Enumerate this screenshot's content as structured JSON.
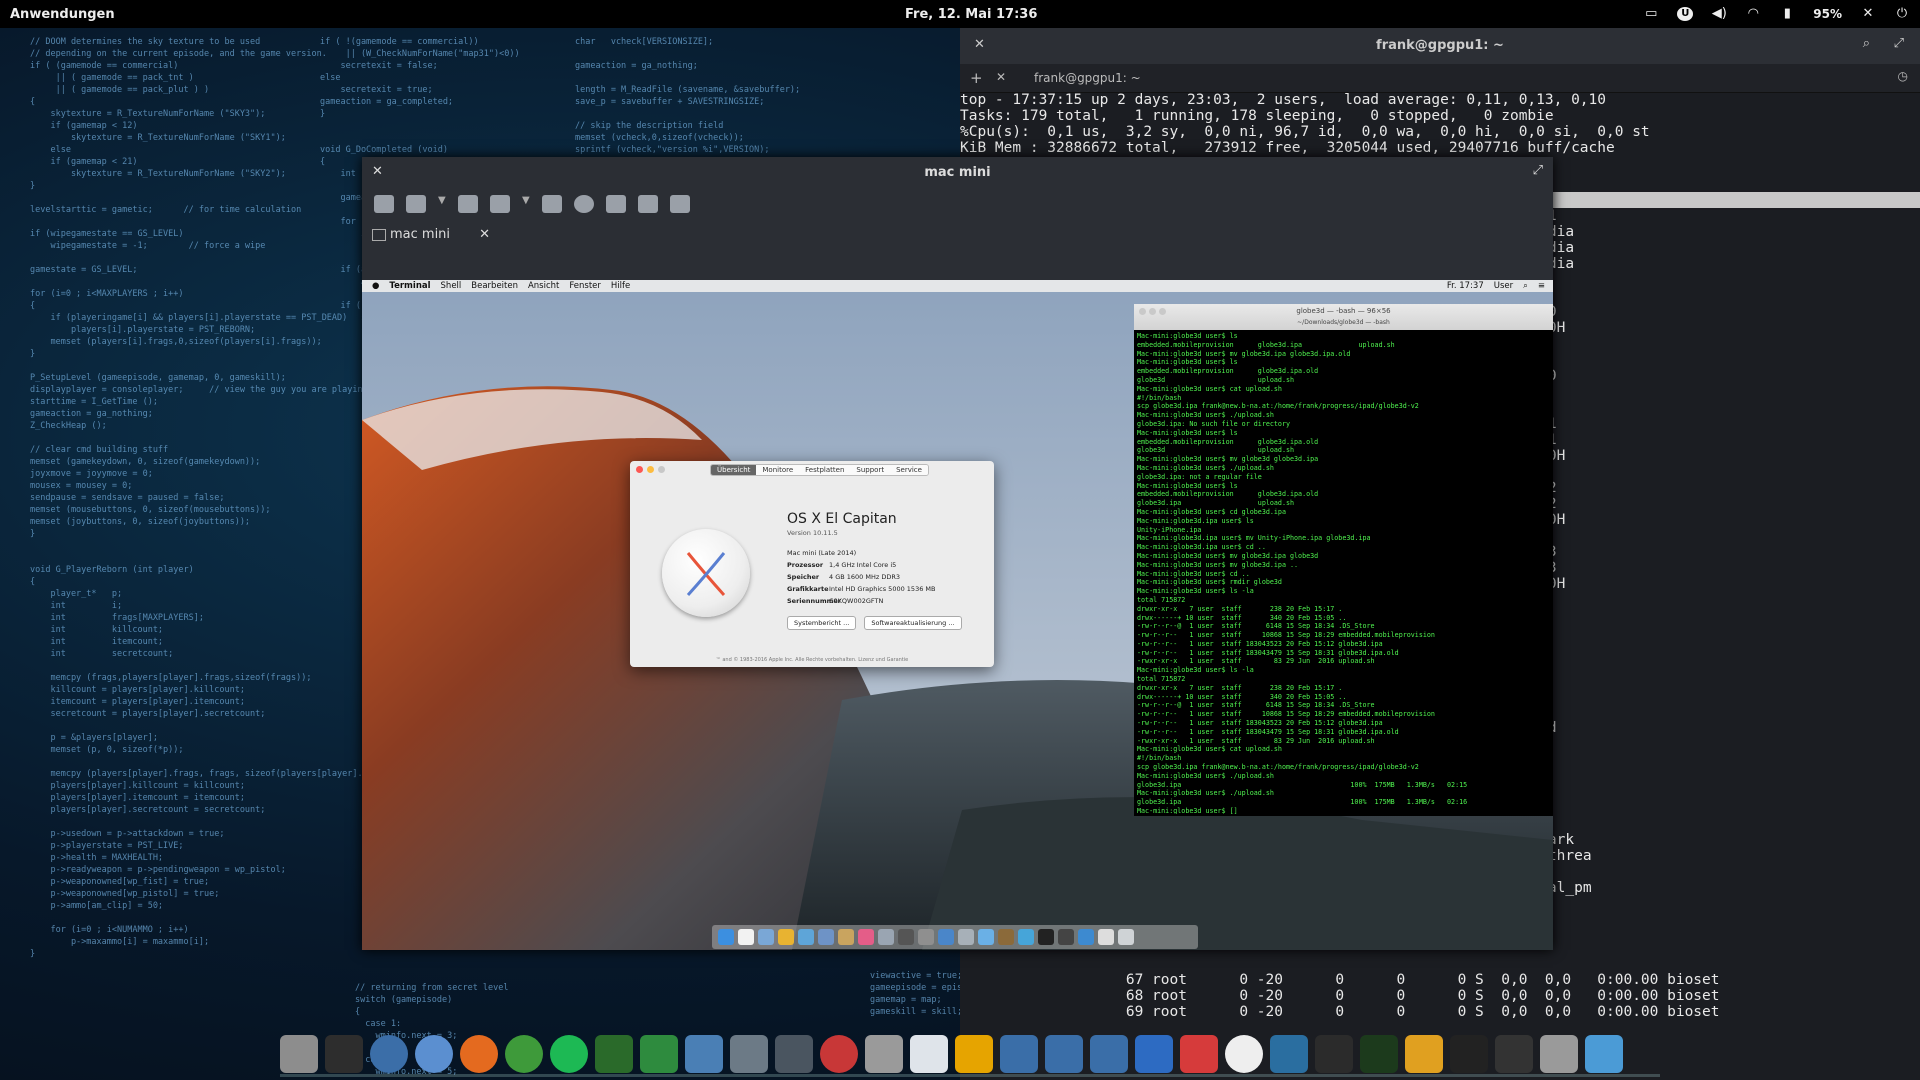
{
  "topbar": {
    "apps_label": "Anwendungen",
    "clock": "Fre, 12. Mai   17:36",
    "battery": "95%",
    "tray_icons": [
      "display-icon",
      "u-app-icon",
      "volume-icon",
      "wifi-icon",
      "battery-icon",
      "notifications-off-icon",
      "power-icon"
    ]
  },
  "terminal": {
    "title": "frank@gpgpu1: ~",
    "tab_label": "frank@gpgpu1: ~",
    "top_lines": [
      "top - 17:37:15 up 2 days, 23:03,  2 users,  load average: 0,11, 0,13, 0,10",
      "Tasks: 179 total,   1 running, 178 sleeping,   0 stopped,   0 zombie",
      "%Cpu(s):  0,1 us,  3,2 sy,  0,0 ni, 96,7 id,  0,0 wa,  0,0 hi,  0,0 si,  0,0 st",
      "KiB Mem : 32886672 total,   273912 free,  3205044 used, 29407716 buff/cache"
    ],
    "proc_right": [
      "D",
      "r/2:1",
      "-nvidia",
      "-nvidia",
      "-nvidia",
      "d",
      "dd",
      "rqd/0",
      "r/0:0H",
      "hed",
      "",
      "ion/0",
      "og/0",
      "og/1",
      "ion/1",
      "rqd/1",
      "r/1:0H",
      "og/2",
      "ion/2",
      "rqd/2",
      "r/2:0H",
      "og/3",
      "ion/3",
      "rqd/3",
      "r/3:0H",
      "pfs",
      "",
      "",
      "askd",
      "ack",
      "",
      "aged",
      "",
      "rityd",
      "",
      "d",
      "f",
      "",
      "q_wq",
      "",
      "fy_mark",
      "fs-kthrea",
      "ld",
      "hermal_pm"
    ],
    "proc_bottom": [
      "                   67 root      0 -20      0      0      0 S  0,0  0,0   0:00.00 bioset",
      "                   68 root      0 -20      0      0      0 S  0,0  0,0   0:00.00 bioset",
      "                   69 root      0 -20      0      0      0 S  0,0  0,0   0:00.00 bioset"
    ]
  },
  "remmina": {
    "title": "mac mini",
    "tab_label": "mac mini"
  },
  "mac": {
    "menubar": [
      "Terminal",
      "Shell",
      "Bearbeiten",
      "Ansicht",
      "Fenster",
      "Hilfe"
    ],
    "menubar_right": [
      "Fr. 17:37",
      "User"
    ],
    "about": {
      "tabs": [
        "Übersicht",
        "Monitore",
        "Festplatten",
        "Support",
        "Service"
      ],
      "os_name": "OS X El Capitan",
      "version": "Version 10.11.5",
      "specs": [
        {
          "k": "",
          "v": "Mac mini (Late 2014)"
        },
        {
          "k": "Prozessor",
          "v": "1,4 GHz Intel Core i5"
        },
        {
          "k": "Speicher",
          "v": "4 GB 1600 MHz DDR3"
        },
        {
          "k": "Grafikkarte",
          "v": "Intel HD Graphics 5000 1536 MB"
        },
        {
          "k": "Seriennummer",
          "v": "C0KQW002GFTN"
        }
      ],
      "buttons": [
        "Systembericht ...",
        "Softwareaktualisierung ..."
      ],
      "footer": "™ and © 1983-2016 Apple Inc. Alle Rechte vorbehalten. Lizenz und Garantie"
    },
    "term": {
      "title": "globe3d — -bash — 96×56",
      "subtitle": "~/Downloads/globe3d — -bash",
      "lines": [
        "Mac-mini:globe3d user$ ls",
        "embedded.mobileprovision      globe3d.ipa              upload.sh",
        "Mac-mini:globe3d user$ mv globe3d.ipa globe3d.ipa.old",
        "Mac-mini:globe3d user$ ls",
        "embedded.mobileprovision      globe3d.ipa.old",
        "globe3d                       upload.sh",
        "Mac-mini:globe3d user$ cat upload.sh",
        "#!/bin/bash",
        "scp globe3d.ipa frank@new.b-na.at:/home/frank/progress/ipad/globe3d-v2",
        "Mac-mini:globe3d user$ ./upload.sh",
        "globe3d.ipa: No such file or directory",
        "Mac-mini:globe3d user$ ls",
        "embedded.mobileprovision      globe3d.ipa.old",
        "globe3d                       upload.sh",
        "Mac-mini:globe3d user$ mv globe3d globe3d.ipa",
        "Mac-mini:globe3d user$ ./upload.sh",
        "globe3d.ipa: not a regular file",
        "Mac-mini:globe3d user$ ls",
        "embedded.mobileprovision      globe3d.ipa.old",
        "globe3d.ipa                   upload.sh",
        "Mac-mini:globe3d user$ cd globe3d.ipa",
        "Mac-mini:globe3d.ipa user$ ls",
        "Unity-iPhone.ipa",
        "Mac-mini:globe3d.ipa user$ mv Unity-iPhone.ipa globe3d.ipa",
        "Mac-mini:globe3d.ipa user$ cd ..",
        "Mac-mini:globe3d user$ mv globe3d.ipa globe3d",
        "Mac-mini:globe3d user$ mv globe3d.ipa ..",
        "Mac-mini:globe3d user$ cd ..",
        "Mac-mini:globe3d user$ rmdir globe3d",
        "Mac-mini:globe3d user$ ls -la",
        "total 715872",
        "drwxr-xr-x   7 user  staff       238 20 Feb 15:17 .",
        "drwx------+ 10 user  staff       340 20 Feb 15:05 ..",
        "-rw-r--r--@  1 user  staff      6148 15 Sep 18:34 .DS_Store",
        "-rw-r--r--   1 user  staff     10868 15 Sep 18:29 embedded.mobileprovision",
        "-rw-r--r--   1 user  staff 183043523 20 Feb 15:12 globe3d.ipa",
        "-rw-r--r--   1 user  staff 183043479 15 Sep 18:31 globe3d.ipa.old",
        "-rwxr-xr-x   1 user  staff        83 29 Jun  2016 upload.sh",
        "Mac-mini:globe3d user$ ls -la",
        "total 715872",
        "drwxr-xr-x   7 user  staff       238 20 Feb 15:17 .",
        "drwx------+ 10 user  staff       340 20 Feb 15:05 ..",
        "-rw-r--r--@  1 user  staff      6148 15 Sep 18:34 .DS_Store",
        "-rw-r--r--   1 user  staff     10868 15 Sep 18:29 embedded.mobileprovision",
        "-rw-r--r--   1 user  staff 183043523 20 Feb 15:12 globe3d.ipa",
        "-rw-r--r--   1 user  staff 183043479 15 Sep 18:31 globe3d.ipa.old",
        "-rwxr-xr-x   1 user  staff        83 29 Jun  2016 upload.sh",
        "Mac-mini:globe3d user$ cat upload.sh",
        "#!/bin/bash",
        "scp globe3d.ipa frank@new.b-na.at:/home/frank/progress/ipad/globe3d-v2",
        "Mac-mini:globe3d user$ ./upload.sh",
        "globe3d.ipa                                          100%  175MB   1.3MB/s   02:15",
        "Mac-mini:globe3d user$ ./upload.sh",
        "globe3d.ipa                                          100%  175MB   1.3MB/s   02:16",
        "Mac-mini:globe3d user$ []"
      ]
    }
  },
  "wallpaper": {
    "col1": "// DOOM determines the sky texture to be used\n// depending on the current episode, and the game version.\nif ( (gamemode == commercial)\n     || ( gamemode == pack_tnt )\n     || ( gamemode == pack_plut ) )\n{\n    skytexture = R_TextureNumForName (\"SKY3\");\n    if (gamemap < 12)\n        skytexture = R_TextureNumForName (\"SKY1\");\n    else\n    if (gamemap < 21)\n        skytexture = R_TextureNumForName (\"SKY2\");\n}\n\nlevelstarttic = gametic;      // for time calculation\n\nif (wipegamestate == GS_LEVEL)\n    wipegamestate = -1;        // force a wipe\n\ngamestate = GS_LEVEL;\n\nfor (i=0 ; i<MAXPLAYERS ; i++)\n{\n    if (playeringame[i] && players[i].playerstate == PST_DEAD)\n        players[i].playerstate = PST_REBORN;\n    memset (players[i].frags,0,sizeof(players[i].frags));\n}\n\nP_SetupLevel (gameepisode, gamemap, 0, gameskill);\ndisplayplayer = consoleplayer;     // view the guy you are playing\nstarttime = I_GetTime ();\ngameaction = ga_nothing;\nZ_CheckHeap ();\n\n// clear cmd building stuff\nmemset (gamekeydown, 0, sizeof(gamekeydown));\njoyxmove = joyymove = 0;\nmousex = mousey = 0;\nsendpause = sendsave = paused = false;\nmemset (mousebuttons, 0, sizeof(mousebuttons));\nmemset (joybuttons, 0, sizeof(joybuttons));\n}\n\n\nvoid G_PlayerReborn (int player)\n{\n    player_t*   p;\n    int         i;\n    int         frags[MAXPLAYERS];\n    int         killcount;\n    int         itemcount;\n    int         secretcount;\n\n    memcpy (frags,players[player].frags,sizeof(frags));\n    killcount = players[player].killcount;\n    itemcount = players[player].itemcount;\n    secretcount = players[player].secretcount;\n\n    p = &players[player];\n    memset (p, 0, sizeof(*p));\n\n    memcpy (players[player].frags, frags, sizeof(players[player].frags));\n    players[player].killcount = killcount;\n    players[player].itemcount = itemcount;\n    players[player].secretcount = secretcount;\n\n    p->usedown = p->attackdown = true;\n    p->playerstate = PST_LIVE;\n    p->health = MAXHEALTH;\n    p->readyweapon = p->pendingweapon = wp_pistol;\n    p->weaponowned[wp_fist] = true;\n    p->weaponowned[wp_pistol] = true;\n    p->ammo[am_clip] = 50;\n\n    for (i=0 ; i<NUMAMMO ; i++)\n        p->maxammo[i] = maxammo[i];\n}",
    "col2": "if ( !(gamemode == commercial))\n     || (W_CheckNumForName(\"map31\")<0))\n    secretexit = false;\nelse\n    secretexit = true;\ngameaction = ga_completed;\n}\n\n\nvoid G_DoCompleted (void)\n{\n    int   i;\n\n    gameaction = ga_nothing;\n\n    for (i=0 ; i<MAXPLAYERS ; i++)\n        if (playeringame[i])\n            G_PlayerFinished (i);\n\n    if (automapactive)\n        AM_Stop ();\n\n    if ( gamemode != commercial)\n        switch(gamemap)\n        {\n          case 8:\n            gameaction = ga_victory;\n            return;\n          case 9:\n            for (i=0 ; i<MAXPLAYERS ; i++)\n                players[i].didsecret = true;\n            break;\n        }",
    "col3": "char   vcheck[VERSIONSIZE];\n\ngameaction = ga_nothing;\n\nlength = M_ReadFile (savename, &savebuffer);\nsave_p = savebuffer + SAVESTRINGSIZE;\n\n// skip the description field\nmemset (vcheck,0,sizeof(vcheck));\nsprintf (vcheck,\"version %i\",VERSION);\nif (strcmp (save_p, vcheck))\n    return;",
    "col4": "// returning from secret level\nswitch (gamepisode)\n{\n  case 1:\n    wminfo.next = 3;\n    break;\n  case 2:\n    wminfo.next = 5;",
    "col5": "viewactive = true;\ngameepisode = episode;\ngamemap = map;\ngameskill = skill;"
  }
}
